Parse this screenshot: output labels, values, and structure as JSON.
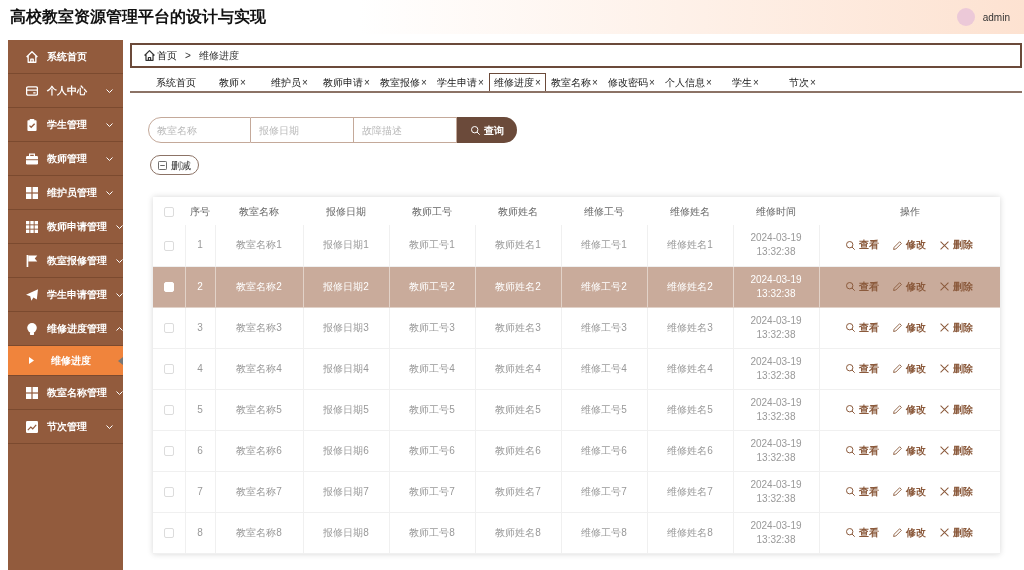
{
  "header": {
    "title": "高校教室资源管理平台的设计与实现",
    "user": "admin"
  },
  "sidebar": {
    "items": [
      {
        "label": "系统首页",
        "kind": "link",
        "selected": false
      },
      {
        "label": "个人中心",
        "kind": "group",
        "expanded": false,
        "selected": false
      },
      {
        "label": "学生管理",
        "kind": "group",
        "expanded": false,
        "selected": false
      },
      {
        "label": "教师管理",
        "kind": "group",
        "expanded": false,
        "selected": false
      },
      {
        "label": "维护员管理",
        "kind": "group",
        "expanded": false,
        "selected": false
      },
      {
        "label": "教师申请管理",
        "kind": "group",
        "expanded": false,
        "selected": false
      },
      {
        "label": "教室报修管理",
        "kind": "group",
        "expanded": false,
        "selected": false
      },
      {
        "label": "学生申请管理",
        "kind": "group",
        "expanded": false,
        "selected": false
      },
      {
        "label": "维修进度管理",
        "kind": "group",
        "expanded": true,
        "selected": false,
        "children": [
          {
            "label": "维修进度",
            "selected": true
          }
        ]
      },
      {
        "label": "教室名称管理",
        "kind": "group",
        "expanded": false,
        "selected": false
      },
      {
        "label": "节次管理",
        "kind": "group",
        "expanded": false,
        "selected": false
      }
    ]
  },
  "breadcrumb": {
    "home": "首页",
    "separator": ">",
    "current": "维修进度"
  },
  "tabs": [
    {
      "label": "系统首页",
      "selected": false
    },
    {
      "label": "教师",
      "close": "×",
      "selected": false
    },
    {
      "label": "维护员",
      "close": "×",
      "selected": false
    },
    {
      "label": "教师申请",
      "close": "×",
      "selected": false
    },
    {
      "label": "教室报修",
      "close": "×",
      "selected": false
    },
    {
      "label": "学生申请",
      "close": "×",
      "selected": false
    },
    {
      "label": "维修进度",
      "close": "×",
      "selected": true
    },
    {
      "label": "教室名称",
      "close": "×",
      "selected": false
    },
    {
      "label": "修改密码",
      "close": "×",
      "selected": false
    },
    {
      "label": "个人信息",
      "close": "×",
      "selected": false
    },
    {
      "label": "学生",
      "close": "×",
      "selected": false
    },
    {
      "label": "节次",
      "close": "×",
      "selected": false
    }
  ],
  "search": {
    "fields": [
      {
        "placeholder": "教室名称"
      },
      {
        "placeholder": "报修日期"
      },
      {
        "placeholder": "故障描述"
      }
    ],
    "button": "查询"
  },
  "toolbar": {
    "delete_button": "删减"
  },
  "table": {
    "all_selected": false,
    "columns": [
      "序号",
      "教室名称",
      "报修日期",
      "教师工号",
      "教师姓名",
      "维修工号",
      "维修姓名",
      "维修时间",
      "操作"
    ],
    "rows": [
      {
        "selected": false,
        "cells": [
          "1",
          "教室名称1",
          "报修日期1",
          "教师工号1",
          "教师姓名1",
          "维修工号1",
          "维修姓名1",
          "2024-03-19 13:32:38"
        ],
        "actions": [
          {
            "kind": "view",
            "label": "查看"
          },
          {
            "kind": "edit",
            "label": "修改"
          },
          {
            "kind": "delete",
            "label": "删除"
          }
        ]
      },
      {
        "selected": true,
        "cells": [
          "2",
          "教室名称2",
          "报修日期2",
          "教师工号2",
          "教师姓名2",
          "维修工号2",
          "维修姓名2",
          "2024-03-19 13:32:38"
        ],
        "actions": [
          {
            "kind": "view",
            "label": "查看"
          },
          {
            "kind": "edit",
            "label": "修改"
          },
          {
            "kind": "delete",
            "label": "删除"
          }
        ]
      },
      {
        "selected": false,
        "cells": [
          "3",
          "教室名称3",
          "报修日期3",
          "教师工号3",
          "教师姓名3",
          "维修工号3",
          "维修姓名3",
          "2024-03-19 13:32:38"
        ],
        "actions": [
          {
            "kind": "view",
            "label": "查看"
          },
          {
            "kind": "edit",
            "label": "修改"
          },
          {
            "kind": "delete",
            "label": "删除"
          }
        ]
      },
      {
        "selected": false,
        "cells": [
          "4",
          "教室名称4",
          "报修日期4",
          "教师工号4",
          "教师姓名4",
          "维修工号4",
          "维修姓名4",
          "2024-03-19 13:32:38"
        ],
        "actions": [
          {
            "kind": "view",
            "label": "查看"
          },
          {
            "kind": "edit",
            "label": "修改"
          },
          {
            "kind": "delete",
            "label": "删除"
          }
        ]
      },
      {
        "selected": false,
        "cells": [
          "5",
          "教室名称5",
          "报修日期5",
          "教师工号5",
          "教师姓名5",
          "维修工号5",
          "维修姓名5",
          "2024-03-19 13:32:38"
        ],
        "actions": [
          {
            "kind": "view",
            "label": "查看"
          },
          {
            "kind": "edit",
            "label": "修改"
          },
          {
            "kind": "delete",
            "label": "删除"
          }
        ]
      },
      {
        "selected": false,
        "cells": [
          "6",
          "教室名称6",
          "报修日期6",
          "教师工号6",
          "教师姓名6",
          "维修工号6",
          "维修姓名6",
          "2024-03-19 13:32:38"
        ],
        "actions": [
          {
            "kind": "view",
            "label": "查看"
          },
          {
            "kind": "edit",
            "label": "修改"
          },
          {
            "kind": "delete",
            "label": "删除"
          }
        ]
      },
      {
        "selected": false,
        "cells": [
          "7",
          "教室名称7",
          "报修日期7",
          "教师工号7",
          "教师姓名7",
          "维修工号7",
          "维修姓名7",
          "2024-03-19 13:32:38"
        ],
        "actions": [
          {
            "kind": "view",
            "label": "查看"
          },
          {
            "kind": "edit",
            "label": "修改"
          },
          {
            "kind": "delete",
            "label": "删除"
          }
        ]
      },
      {
        "selected": false,
        "cells": [
          "8",
          "教室名称8",
          "报修日期8",
          "教师工号8",
          "教师姓名8",
          "维修工号8",
          "维修姓名8",
          "2024-03-19 13:32:38"
        ],
        "actions": [
          {
            "kind": "view",
            "label": "查看"
          },
          {
            "kind": "edit",
            "label": "修改"
          },
          {
            "kind": "delete",
            "label": "删除"
          }
        ]
      }
    ]
  }
}
